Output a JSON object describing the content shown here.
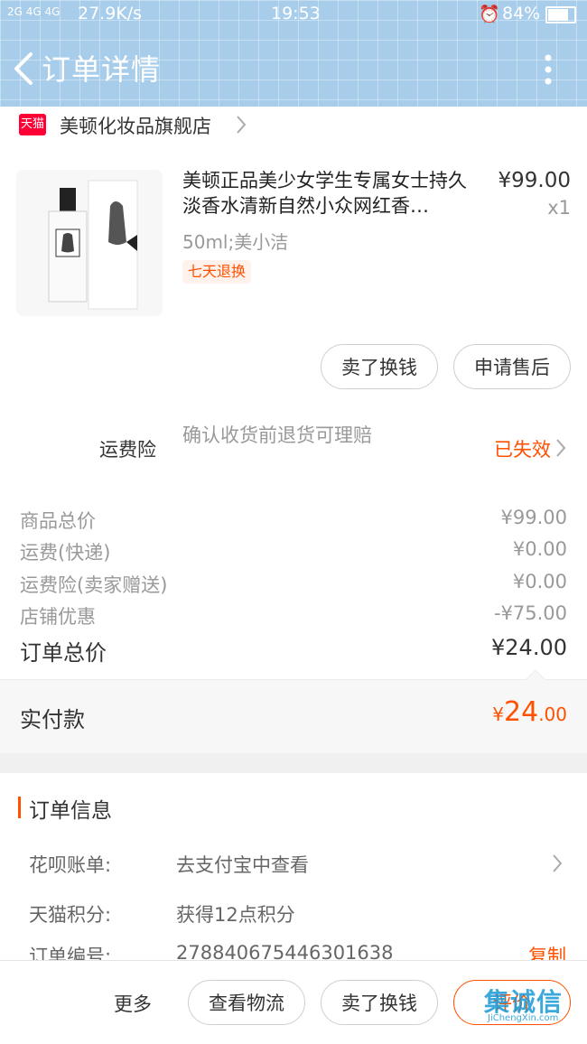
{
  "status_bar": {
    "network": "2G 4G 4G",
    "speed": "27.9K/s",
    "time": "19:53",
    "battery": "84%"
  },
  "nav": {
    "title": "订单详情"
  },
  "shop": {
    "badge": "天猫",
    "name": "美顿化妆品旗舰店"
  },
  "product": {
    "title": "美顿正品美少女学生专属女士持久淡香水清新自然小众网红香…",
    "price": "¥99.00",
    "qty": "x1",
    "sku": "50ml;美小洁",
    "tag": "七天退换"
  },
  "actions": {
    "sell": "卖了换钱",
    "after_sale": "申请售后"
  },
  "insurance": {
    "label": "运费险",
    "desc": "确认收货前退货可理赔",
    "status": "已失效"
  },
  "price_rows": [
    {
      "label": "商品总价",
      "value": "¥99.00"
    },
    {
      "label": "运费(快递)",
      "value": "¥0.00"
    },
    {
      "label": "运费险(卖家赠送)",
      "value": "¥0.00"
    },
    {
      "label": "店铺优惠",
      "value": "-¥75.00"
    }
  ],
  "order_total": {
    "label": "订单总价",
    "value": "¥24.00"
  },
  "paid": {
    "label": "实付款",
    "currency": "¥",
    "integer": "24",
    "decimal": ".00"
  },
  "order_info": {
    "heading": "订单信息",
    "rows": [
      {
        "label": "花呗账单:",
        "value": "去支付宝中查看"
      },
      {
        "label": "天猫积分:",
        "value": "获得12点积分"
      },
      {
        "label": "订单编号:",
        "value": "278840675446301638",
        "action": "复制"
      }
    ]
  },
  "bottom_bar": {
    "more": "更多",
    "logistics": "查看物流",
    "sell": "卖了换钱",
    "review": "评价"
  },
  "watermark": {
    "text": "集诚信",
    "sub": "JiChengXin.com"
  },
  "colors": {
    "header": "#a8cdea",
    "accent": "#ff5000",
    "tmall_red": "#ff0036"
  }
}
